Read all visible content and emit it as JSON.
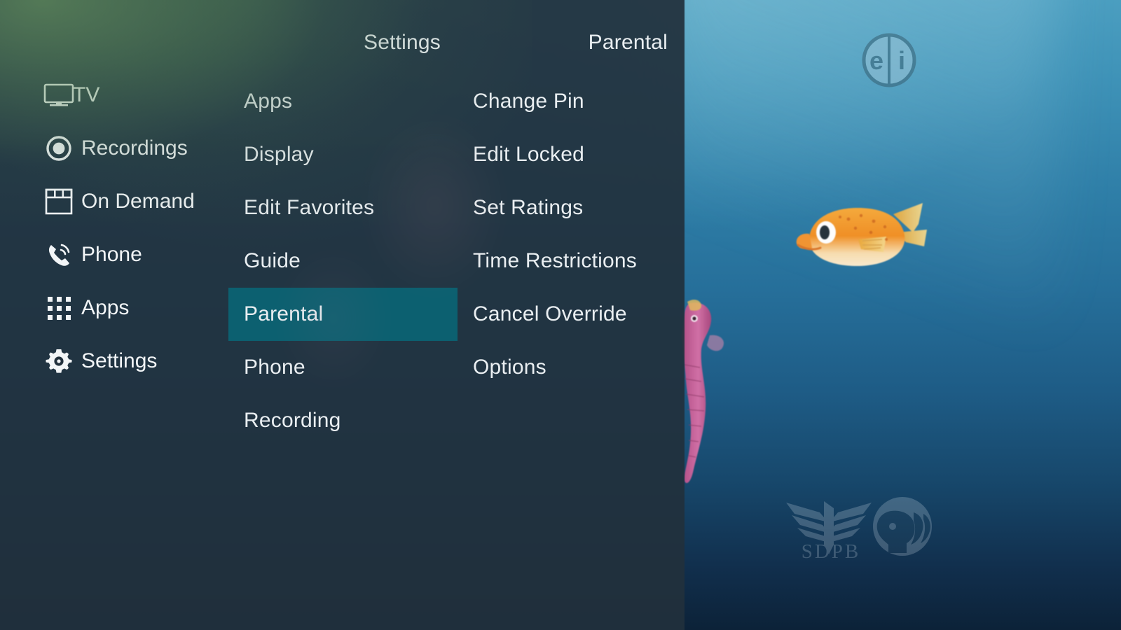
{
  "colors": {
    "panel_bg": "#21303c",
    "selection_teal": "#0c6070",
    "text_primary": "#e9eef1",
    "ocean_top": "#4b9ec0",
    "ocean_bottom": "#0c2238",
    "green_wash": "#6e9e60",
    "fish_orange": "#f0952f",
    "seahorse_pink": "#c8609a"
  },
  "main_menu": {
    "items": [
      {
        "label": "TV",
        "icon": "tv-icon"
      },
      {
        "label": "Recordings",
        "icon": "record-circle-icon"
      },
      {
        "label": "On Demand",
        "icon": "on-demand-icon"
      },
      {
        "label": "Phone",
        "icon": "phone-icon"
      },
      {
        "label": "Apps",
        "icon": "apps-grid-icon"
      },
      {
        "label": "Settings",
        "icon": "gear-icon"
      }
    ]
  },
  "settings_menu": {
    "heading": "Settings",
    "items": [
      {
        "label": "Apps",
        "selected": false
      },
      {
        "label": "Display",
        "selected": false
      },
      {
        "label": "Edit Favorites",
        "selected": false
      },
      {
        "label": "Guide",
        "selected": false
      },
      {
        "label": "Parental",
        "selected": true
      },
      {
        "label": "Phone",
        "selected": false
      },
      {
        "label": "Recording",
        "selected": false
      }
    ]
  },
  "parental_menu": {
    "heading": "Parental",
    "items": [
      {
        "label": "Change Pin",
        "selected": false
      },
      {
        "label": "Edit Locked",
        "selected": false
      },
      {
        "label": "Set Ratings",
        "selected": false
      },
      {
        "label": "Time Restrictions",
        "selected": false
      },
      {
        "label": "Cancel Override",
        "selected": false
      },
      {
        "label": "Options",
        "selected": false
      }
    ]
  },
  "video": {
    "rating_bug": "ei-rating-icon",
    "rating_bug_letters": {
      "left": "e",
      "right": "i"
    },
    "watermark_text": "SDPB",
    "watermark_logos": [
      "sdpb-wing-logo",
      "pbs-head-logo"
    ],
    "subjects": [
      "boxfish",
      "seahorse"
    ]
  }
}
